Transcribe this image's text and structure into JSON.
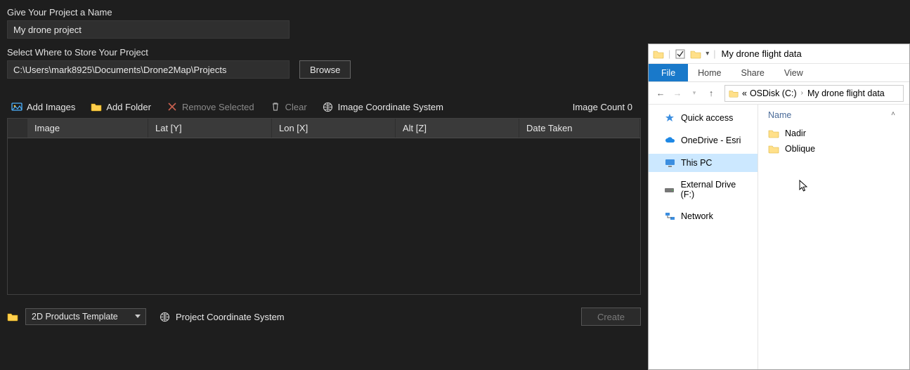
{
  "project": {
    "name_label": "Give Your Project a Name",
    "name_value": "My drone project",
    "store_label": "Select Where to Store Your Project",
    "path": "C:\\Users\\mark8925\\Documents\\Drone2Map\\Projects",
    "browse_label": "Browse"
  },
  "toolbar": {
    "add_images": "Add Images",
    "add_folder": "Add Folder",
    "remove_selected": "Remove Selected",
    "clear": "Clear",
    "image_coord": "Image Coordinate System",
    "count_label": "Image Count 0"
  },
  "table": {
    "headers": {
      "image": "Image",
      "lat": "Lat [Y]",
      "lon": "Lon [X]",
      "alt": "Alt [Z]",
      "date": "Date Taken"
    },
    "rows": []
  },
  "footer": {
    "template_selected": "2D Products Template",
    "proj_coord": "Project Coordinate System",
    "create": "Create"
  },
  "explorer": {
    "title": "My drone flight data",
    "ribbon": {
      "file": "File",
      "home": "Home",
      "share": "Share",
      "view": "View"
    },
    "breadcrumb": {
      "pre": "«",
      "drive": "OSDisk (C:)",
      "folder": "My drone flight data"
    },
    "sidebar": {
      "quick": "Quick access",
      "onedrive": "OneDrive - Esri",
      "thispc": "This PC",
      "external": "External Drive (F:)",
      "network": "Network"
    },
    "column_header": "Name",
    "items": [
      {
        "name": "Nadir"
      },
      {
        "name": "Oblique"
      }
    ]
  }
}
